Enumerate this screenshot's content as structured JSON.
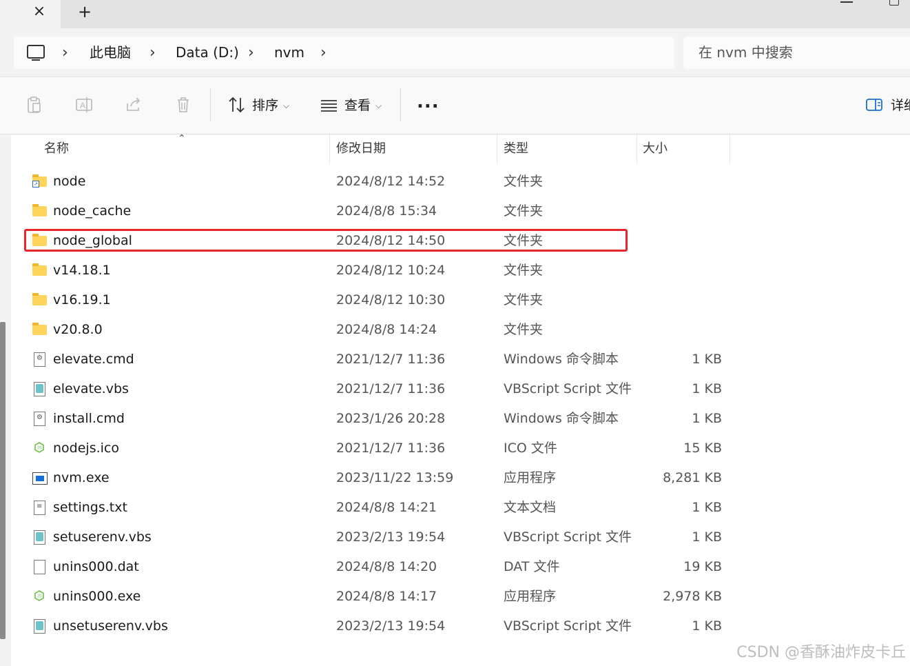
{
  "tabbar": {
    "close_glyph": "×",
    "add_glyph": "+"
  },
  "address": {
    "crumbs": [
      "此电脑",
      "Data (D:)",
      "nvm"
    ],
    "chevron": "›",
    "icon": "computer-icon"
  },
  "search": {
    "placeholder": "在 nvm 中搜索"
  },
  "toolbar": {
    "icons": [
      "paste-icon",
      "rename-icon",
      "share-icon",
      "delete-icon"
    ],
    "sort_label": "排序",
    "view_label": "查看",
    "more_label": "...",
    "details_label": "详细"
  },
  "list": {
    "columns": {
      "name": "名称",
      "date": "修改日期",
      "type": "类型",
      "size": "大小"
    },
    "rows": [
      {
        "name": "node",
        "date": "2024/8/12 14:52",
        "type": "文件夹",
        "size": "",
        "icon": "folder-shortcut"
      },
      {
        "name": "node_cache",
        "date": "2024/8/8 15:34",
        "type": "文件夹",
        "size": "",
        "icon": "folder"
      },
      {
        "name": "node_global",
        "date": "2024/8/12 14:50",
        "type": "文件夹",
        "size": "",
        "icon": "folder"
      },
      {
        "name": "v14.18.1",
        "date": "2024/8/12 10:24",
        "type": "文件夹",
        "size": "",
        "icon": "folder"
      },
      {
        "name": "v16.19.1",
        "date": "2024/8/12 10:30",
        "type": "文件夹",
        "size": "",
        "icon": "folder"
      },
      {
        "name": "v20.8.0",
        "date": "2024/8/8 14:24",
        "type": "文件夹",
        "size": "",
        "icon": "folder"
      },
      {
        "name": "elevate.cmd",
        "date": "2021/12/7 11:36",
        "type": "Windows 命令脚本",
        "size": "1 KB",
        "icon": "cmd"
      },
      {
        "name": "elevate.vbs",
        "date": "2021/12/7 11:36",
        "type": "VBScript Script 文件",
        "size": "1 KB",
        "icon": "vbs"
      },
      {
        "name": "install.cmd",
        "date": "2023/1/26 20:28",
        "type": "Windows 命令脚本",
        "size": "1 KB",
        "icon": "cmd"
      },
      {
        "name": "nodejs.ico",
        "date": "2021/12/7 11:36",
        "type": "ICO 文件",
        "size": "15 KB",
        "icon": "nodejs"
      },
      {
        "name": "nvm.exe",
        "date": "2023/11/22 13:59",
        "type": "应用程序",
        "size": "8,281 KB",
        "icon": "exe"
      },
      {
        "name": "settings.txt",
        "date": "2024/8/8 14:21",
        "type": "文本文档",
        "size": "1 KB",
        "icon": "txt"
      },
      {
        "name": "setuserenv.vbs",
        "date": "2023/2/13 19:54",
        "type": "VBScript Script 文件",
        "size": "1 KB",
        "icon": "vbs"
      },
      {
        "name": "unins000.dat",
        "date": "2024/8/8 14:20",
        "type": "DAT 文件",
        "size": "19 KB",
        "icon": "blank"
      },
      {
        "name": "unins000.exe",
        "date": "2024/8/8 14:17",
        "type": "应用程序",
        "size": "2,978 KB",
        "icon": "nodejs"
      },
      {
        "name": "unsetuserenv.vbs",
        "date": "2023/2/13 19:54",
        "type": "VBScript Script 文件",
        "size": "1 KB",
        "icon": "vbs"
      }
    ],
    "highlighted_row": "node_global"
  },
  "colors": {
    "highlight": "#e8252a",
    "folder": "#ffd45a",
    "accent": "#1570d6"
  },
  "watermark": "CSDN @香酥油炸皮卡丘"
}
